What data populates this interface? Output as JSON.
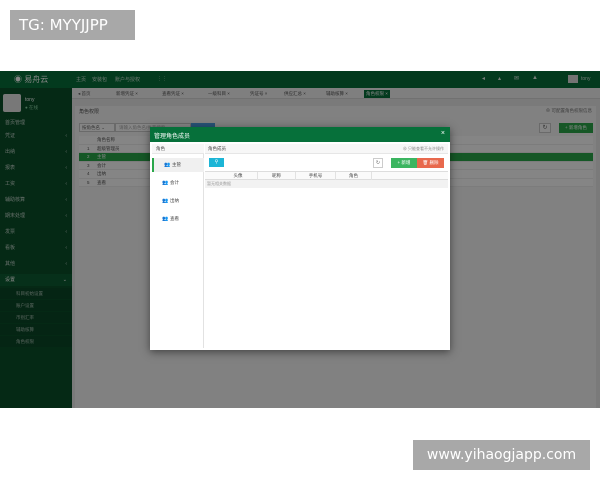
{
  "watermarks": {
    "top_left": "TG: MYYJJPP",
    "bottom_right": "www.yihaogjapp.com"
  },
  "app": {
    "logo": "易舟云",
    "top_links": [
      "主页",
      "安装包",
      "账户与授权",
      "⋮⋮"
    ],
    "top_icons": [
      "◂",
      "▴",
      "✉",
      "▲"
    ],
    "user_label": "tony"
  },
  "tabs": [
    {
      "label": "◂  首页",
      "active": false
    },
    {
      "label": "新增凭证 ×",
      "active": false
    },
    {
      "label": "查看凭证 ×",
      "active": false
    },
    {
      "label": "一级科目 ×",
      "active": false
    },
    {
      "label": "凭证号 ×",
      "active": false
    },
    {
      "label": "供应汇总 ×",
      "active": false
    },
    {
      "label": "辅助核算 ×",
      "active": false
    },
    {
      "label": "角色权限 ×",
      "active": true
    }
  ],
  "sidebar": {
    "username": "tony",
    "status": "● 在线",
    "items": [
      {
        "label": "首页管理",
        "arrow": ""
      },
      {
        "label": "凭证",
        "arrow": "‹"
      },
      {
        "label": "出纳",
        "arrow": "‹"
      },
      {
        "label": "报表",
        "arrow": "‹"
      },
      {
        "label": "工资",
        "arrow": "‹"
      },
      {
        "label": "辅助核算",
        "arrow": "‹"
      },
      {
        "label": "期末处理",
        "arrow": "‹"
      },
      {
        "label": "发票",
        "arrow": "‹"
      },
      {
        "label": "看板",
        "arrow": "‹"
      },
      {
        "label": "其他",
        "arrow": "‹"
      },
      {
        "label": "设置",
        "arrow": "⌄"
      }
    ],
    "subitems": [
      "科目初始设置",
      "账户设置",
      "币别汇率",
      "辅助核算",
      "角色权限"
    ]
  },
  "content": {
    "title": "角色权限",
    "note": "⊗ 可配置角色权限信息",
    "search_select": "按角色名 ⌄",
    "search_placeholder": "请输入角色名/拼音搜索",
    "refresh": "↻",
    "add_label": "+ 新增角色",
    "header": "角色名称",
    "rows": [
      {
        "no": "1",
        "name": "超级管理员",
        "highlight": false
      },
      {
        "no": "2",
        "name": "主管",
        "highlight": true
      },
      {
        "no": "3",
        "name": "会计",
        "highlight": false
      },
      {
        "no": "4",
        "name": "出纳",
        "highlight": false
      },
      {
        "no": "5",
        "name": "查看",
        "highlight": false
      }
    ]
  },
  "modal": {
    "title": "管理角色成员",
    "close": "×",
    "roles_header": "角色",
    "roles": [
      "主管",
      "会计",
      "出纳",
      "查看"
    ],
    "members_header": "角色成员",
    "members_note": "⊗ 只能查看不允许操作",
    "search_icon": "⚲",
    "refresh": "↻",
    "add_label": "+ 新增",
    "delete_label": "🗑 删除",
    "columns": [
      "头像",
      "昵称",
      "手机号",
      "角色"
    ],
    "empty_text": "暂无相关数据"
  }
}
